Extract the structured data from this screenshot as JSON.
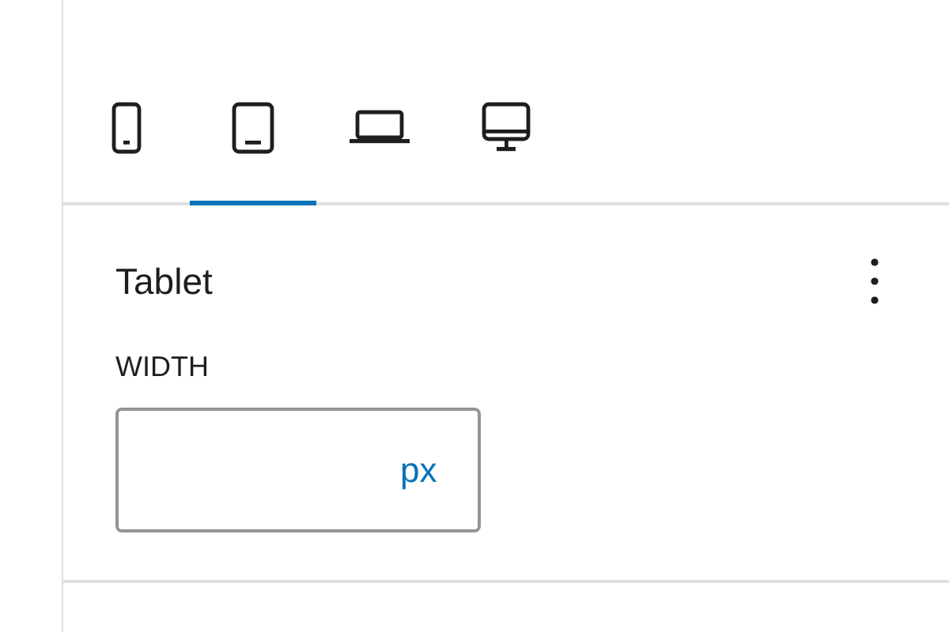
{
  "device_tabs": [
    {
      "kind": "mobile",
      "selected": false
    },
    {
      "kind": "tablet",
      "selected": true
    },
    {
      "kind": "laptop",
      "selected": false
    },
    {
      "kind": "desktop",
      "selected": false
    }
  ],
  "panel": {
    "title": "Tablet",
    "field": {
      "label": "WIDTH",
      "unit": "px"
    }
  }
}
